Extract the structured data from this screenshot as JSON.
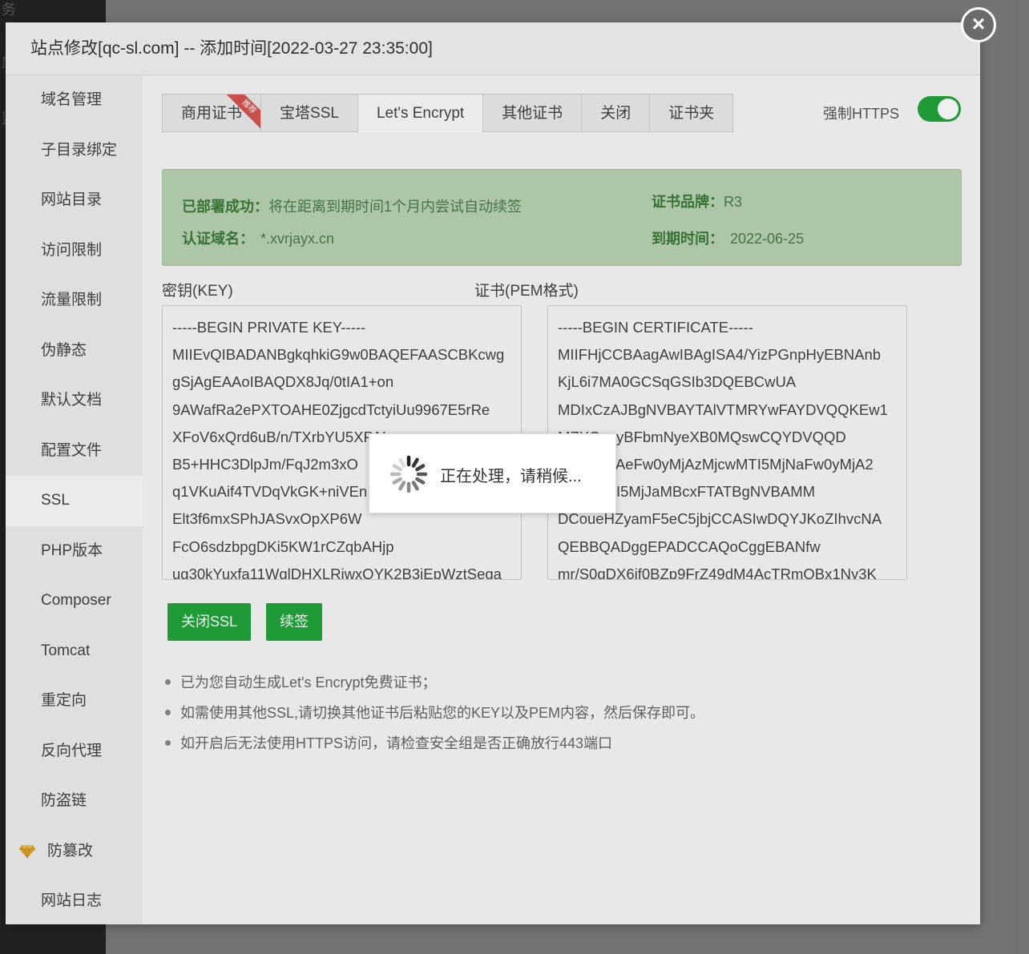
{
  "background": {
    "side_glyphs": [
      "务",
      "应",
      "监"
    ]
  },
  "modal": {
    "title": "站点修改[qc-sl.com] -- 添加时间[2022-03-27 23:35:00]",
    "close_glyph": "×"
  },
  "menu": {
    "items": [
      "域名管理",
      "子目录绑定",
      "网站目录",
      "访问限制",
      "流量限制",
      "伪静态",
      "默认文档",
      "配置文件",
      "SSL",
      "PHP版本",
      "Composer",
      "Tomcat",
      "重定向",
      "反向代理",
      "防盗链",
      "防篡改",
      "网站日志"
    ],
    "active": "SSL"
  },
  "tabs": {
    "items": [
      "商用证书",
      "宝塔SSL",
      "Let's Encrypt",
      "其他证书",
      "关闭",
      "证书夹"
    ],
    "active": "Let's Encrypt",
    "ribbon": "推荐"
  },
  "force_https": {
    "label": "强制HTTPS",
    "enabled": true
  },
  "status": {
    "deployed_label": "已部署成功：",
    "deployed_value": "将在距离到期时间1个月内尝试自动续签",
    "domain_label": "认证域名：",
    "domain_value": "*.xvrjayx.cn",
    "brand_label": "证书品牌：",
    "brand_value": "R3",
    "expire_label": "到期时间：",
    "expire_value": "2022-06-25"
  },
  "key": {
    "label": "密钥(KEY)",
    "lines": [
      "-----BEGIN PRIVATE KEY-----",
      "MIIEvQIBADANBgkqhkiG9w0BAQEFAASCBKcwg",
      "gSjAgEAAoIBAQDX8Jq/0tIA1+on",
      "9AWafRa2ePXTOAHE0ZjgcdTctyiUu9967E5rRe",
      "XFoV6xQrd6uB/n/TXrbYU5XPAL",
      "B5+HHC3DlpJm/FqJ2m3xO",
      "q1VKuAif4TVDqVkGK+niVEn",
      "Elt3f6mxSPhJASvxOpXP6W",
      "FcO6sdzbpgDKi5KW1rCZqbAHjp",
      "ug30kYuxfa11WglDHXLRjwxQYK2B3iEpWztSeqa"
    ]
  },
  "cert": {
    "label": "证书(PEM格式)",
    "lines": [
      "-----BEGIN CERTIFICATE-----",
      "MIIFHjCCBAagAwIBAgISA4/YizPGnpHyEBNAnb",
      "KjL6i7MA0GCSqGSIb3DQEBCwUA",
      "MDIxCzAJBgNVBAYTAlVTMRYwFAYDVQQKEw1",
      "MZXQncyBFbmNyeXB0MQswCQYDVQQD",
      "EwJSMzAeFw0yMjAzMjcwMTI5MjNaFw0yMjA2",
      "MjUwMTI5MjJaMBcxFTATBgNVBAMM",
      "DCoueHZyamF5eC5jbjCCASIwDQYJKoZIhvcNA",
      "QEBBQADggEPADCCAQoCggEBANfw",
      "mr/S0gDX6if0BZp9FrZ49dM4AcTRmOBx1Ny3K"
    ]
  },
  "buttons": {
    "close_ssl": "关闭SSL",
    "renew": "续签"
  },
  "tips": [
    "已为您自动生成Let's Encrypt免费证书；",
    "如需使用其他SSL,请切换其他证书后粘贴您的KEY以及PEM内容，然后保存即可。",
    "如开启后无法使用HTTPS访问，请检查安全组是否正确放行443端口"
  ],
  "loading": {
    "text": "正在处理，请稍候..."
  },
  "colors": {
    "accent": "#20a53a",
    "status_bg": "#b7d3b2",
    "ribbon": "#d9534f"
  }
}
